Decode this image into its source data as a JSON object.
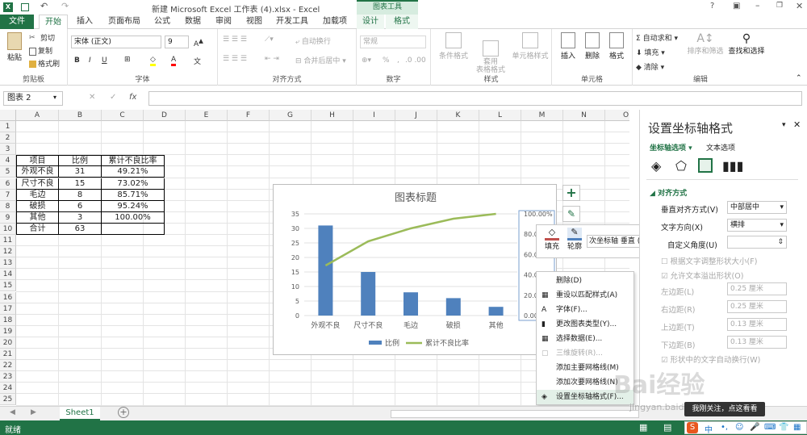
{
  "window": {
    "title": "新建 Microsoft Excel 工作表 (4).xlsx - Excel",
    "context_tool": "图表工具",
    "help": "?"
  },
  "tabs": {
    "file": "文件",
    "home": "开始",
    "insert": "插入",
    "layout": "页面布局",
    "formulas": "公式",
    "data": "数据",
    "review": "审阅",
    "view": "视图",
    "developer": "开发工具",
    "addins": "加载项",
    "design": "设计",
    "format": "格式"
  },
  "ribbon": {
    "clipboard": {
      "label": "剪贴板",
      "paste": "粘贴",
      "cut": "剪切",
      "copy": "复制",
      "painter": "格式刷"
    },
    "font": {
      "label": "字体",
      "name": "宋体 (正文)",
      "size": "9",
      "bold": "B",
      "italic": "I",
      "underline": "U"
    },
    "align": {
      "label": "对齐方式",
      "wrap": "自动换行",
      "merge": "合并后居中"
    },
    "number": {
      "label": "数字",
      "format": "常规",
      "pct": "%",
      "comma": ","
    },
    "styles": {
      "label": "样式",
      "cond": "条件格式",
      "table": "套用\n表格格式",
      "cell": "单元格样式"
    },
    "cells": {
      "label": "单元格",
      "insert": "插入",
      "delete": "删除",
      "format": "格式"
    },
    "edit": {
      "label": "编辑",
      "autosum": "自动求和",
      "fill": "填充",
      "clear": "清除",
      "sort": "排序和筛选",
      "find": "查找和选择"
    }
  },
  "formula_bar": {
    "name_box": "图表 2",
    "fx": "fx",
    "value": ""
  },
  "columns": [
    "A",
    "B",
    "C",
    "D",
    "E",
    "F",
    "G",
    "H",
    "I",
    "J",
    "K",
    "L",
    "M",
    "N",
    "O"
  ],
  "rows": [
    "1",
    "2",
    "3",
    "4",
    "5",
    "6",
    "7",
    "8",
    "9",
    "10",
    "11",
    "12",
    "13",
    "14",
    "15",
    "16",
    "17",
    "18",
    "19",
    "20",
    "21",
    "22",
    "23",
    "24",
    "25",
    "26"
  ],
  "table": {
    "headers": [
      "项目",
      "比例",
      "累计不良比率"
    ],
    "rows": [
      [
        "外观不良",
        "31",
        "49.21%"
      ],
      [
        "尺寸不良",
        "15",
        "73.02%"
      ],
      [
        "毛边",
        "8",
        "85.71%"
      ],
      [
        "破损",
        "6",
        "95.24%"
      ],
      [
        "其他",
        "3",
        "100.00%"
      ]
    ],
    "total": [
      "合计",
      "63",
      ""
    ]
  },
  "chart_data": {
    "type": "bar",
    "title": "图表标题",
    "categories": [
      "外观不良",
      "尺寸不良",
      "毛边",
      "破损",
      "其他"
    ],
    "series": [
      {
        "name": "比例",
        "type": "bar",
        "values": [
          31,
          15,
          8,
          6,
          3
        ]
      },
      {
        "name": "累计不良比率",
        "type": "line",
        "axis": "secondary",
        "values": [
          49.21,
          73.02,
          85.71,
          95.24,
          100.0
        ]
      }
    ],
    "ylim": [
      0,
      35
    ],
    "yticks": [
      "0",
      "5",
      "10",
      "15",
      "20",
      "25",
      "30",
      "35"
    ],
    "y2lim": [
      0,
      100
    ],
    "y2ticks": [
      "0.00%",
      "20.00%",
      "40.00%",
      "60.00%",
      "80.00%",
      "100.00%"
    ],
    "legend": "bottom",
    "colors": {
      "bar": "#4f81bd",
      "line": "#9bbb59"
    }
  },
  "mini_toolbar": {
    "fill": "填充",
    "outline": "轮廓",
    "element": "次坐标轴 垂直 ("
  },
  "context_menu": [
    "删除(D)",
    "重设以匹配样式(A)",
    "字体(F)...",
    "更改图表类型(Y)...",
    "选择数据(E)...",
    "三维旋转(R)...",
    "添加主要网格线(M)",
    "添加次要网格线(N)",
    "设置坐标轴格式(F)..."
  ],
  "pane": {
    "title": "设置坐标轴格式",
    "tab_axis": "坐标轴选项",
    "tab_text": "文本选项",
    "section": "对齐方式",
    "valign_label": "垂直对齐方式(V)",
    "valign": "中部居中",
    "dir_label": "文字方向(X)",
    "dir": "横排",
    "angle_label": "自定义角度(U)",
    "autofit": "根据文字调整形状大小(F)",
    "overflow": "允许文本溢出形状(O)",
    "left_label": "左边距(L)",
    "left": "0.25 厘米",
    "right_label": "右边距(R)",
    "right": "0.25 厘米",
    "top_label": "上边距(T)",
    "top": "0.13 厘米",
    "bottom_label": "下边距(B)",
    "bottom": "0.13 厘米",
    "wrap": "形状中的文字自动换行(W)"
  },
  "sheet_tab": "Sheet1",
  "status": {
    "ready": "就绪"
  },
  "watermark": {
    "brand": "Bai经验",
    "site": "jingyan.baidu.com",
    "tip": "我刚关注，点这看看"
  }
}
